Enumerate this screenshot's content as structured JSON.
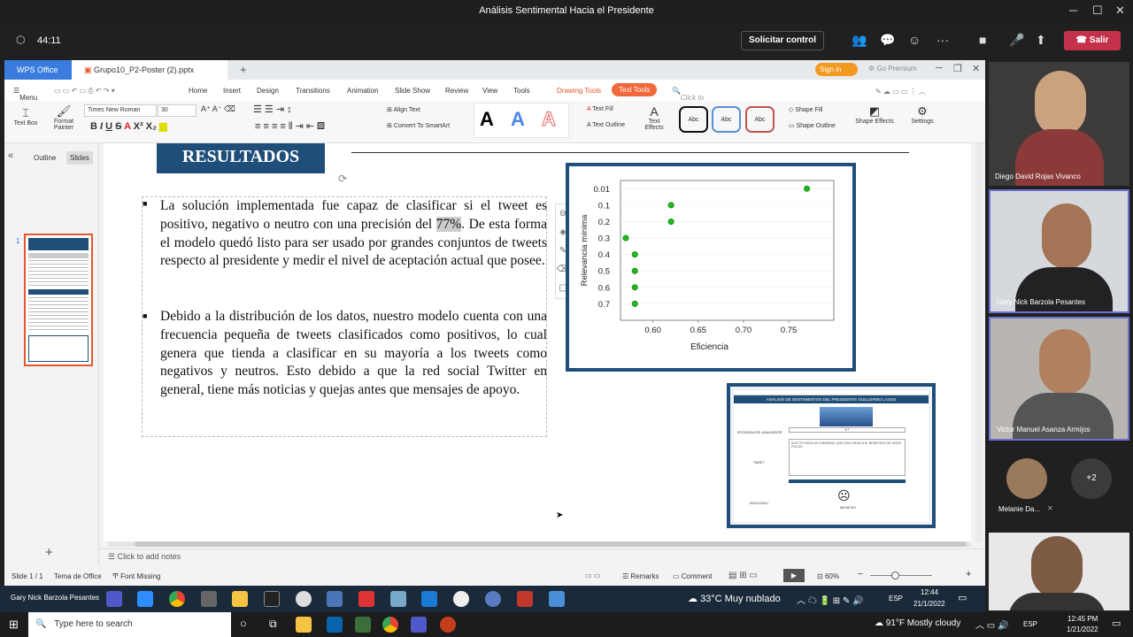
{
  "window_title": "Análisis Sentimental Hacia el Presidente",
  "meeting": {
    "timer": "44:11",
    "request_control": "Solicitar control",
    "leave": "Salir"
  },
  "wps": {
    "tabs": [
      "WPS Office",
      "Grupo10_P2-Poster (2).pptx"
    ],
    "sign_in": "Sign in",
    "premium": "Go Premium",
    "menu": [
      "Menu",
      "Home",
      "Insert",
      "Design",
      "Transitions",
      "Animation",
      "Slide Show",
      "Review",
      "View",
      "Tools",
      "Drawing Tools",
      "Text Tools"
    ],
    "search": "Click to find commands",
    "ribbon": {
      "text_box": "Text Box",
      "format_painter": "Format Painter",
      "font": "Times New Roman",
      "size": "30",
      "align_text": "Align Text",
      "convert": "Convert To SmartArt",
      "text_fill": "Text Fill",
      "text_outline": "Text Outline",
      "text_effects": "Text Effects",
      "abc": "Abc",
      "shape_fill": "Shape Fill",
      "shape_outline": "Shape Outline",
      "shape_effects": "Shape Effects",
      "settings": "Settings"
    },
    "panel_tabs": [
      "Outline",
      "Slides"
    ],
    "slide_num": "1",
    "slide": {
      "heading": "RESULTADOS",
      "p1a": "La solución implementada fue capaz de clasificar si el tweet es positivo, negativo o neutro con una precisión del ",
      "p1hl": "77%",
      "p1b": ". De esta forma el modelo quedó listo para ser usado por grandes conjuntos de tweets respecto al presidente y medir el nivel de aceptación actual que posee.",
      "p2": "Debido a la distribución de los datos, nuestro modelo cuenta con una frecuencia pequeña de tweets clasificados como positivos, lo cual genera que tienda a clasificar en su mayoría a los tweets como negativos y neutros. Esto debido a que la red social Twitter en general, tiene más noticias y quejas antes que mensajes de apoyo.",
      "app_title": "ANÁLISIS DE SENTIMIENTOS DEL PRESIDENTE GUILLERMO LASSO",
      "app_label1": "EFICIENCIA DEL ANALIZADOR",
      "app_label2": "TWEET",
      "app_label3": "RESULTADO",
      "app_value": "0.7",
      "app_result": "NEGATIVO",
      "app_tweet": "ELECTO PARA UN GOBIERNO QUE SOLO BUSCA EL BENEFICIO DE UNOS POCOS"
    },
    "notes": "Click to add notes",
    "status": {
      "slide": "Slide 1 / 1",
      "theme": "Tema de Office",
      "font_missing": "Font Missing",
      "remarks": "Remarks",
      "comment": "Comment",
      "zoom": "60%"
    }
  },
  "chart_data": {
    "type": "scatter",
    "xlabel": "Eficiencia",
    "ylabel": "Relevancia mínima",
    "categories": [
      "0.01",
      "0.1",
      "0.2",
      "0.3",
      "0.4",
      "0.5",
      "0.6",
      "0.7"
    ],
    "xticks": [
      "0.60",
      "0.65",
      "0.70",
      "0.75"
    ],
    "xlim": [
      0.57,
      0.79
    ],
    "points": [
      {
        "x": 0.77,
        "y": "0.01"
      },
      {
        "x": 0.62,
        "y": "0.1"
      },
      {
        "x": 0.62,
        "y": "0.2"
      },
      {
        "x": 0.57,
        "y": "0.3"
      },
      {
        "x": 0.58,
        "y": "0.4"
      },
      {
        "x": 0.58,
        "y": "0.5"
      },
      {
        "x": 0.58,
        "y": "0.6"
      },
      {
        "x": 0.58,
        "y": "0.7"
      }
    ],
    "color": "#1db91d"
  },
  "participants": [
    "Diego David Rojas Vivanco",
    "Gary Nick Barzola Pesantes",
    "Victor Manuel Asanza Armijos",
    "Melanie Da...",
    "+2"
  ],
  "taskbar_user": "Gary Nick Barzola Pesantes",
  "weather1": "33°C  Muy nublado",
  "lang1": "ESP",
  "time1": "12:44",
  "date1": "21/1/2022",
  "search": "Type here to search",
  "weather2": "91°F  Mostly cloudy",
  "lang2": "ESP",
  "time2": "12:45 PM",
  "date2": "1/21/2022"
}
